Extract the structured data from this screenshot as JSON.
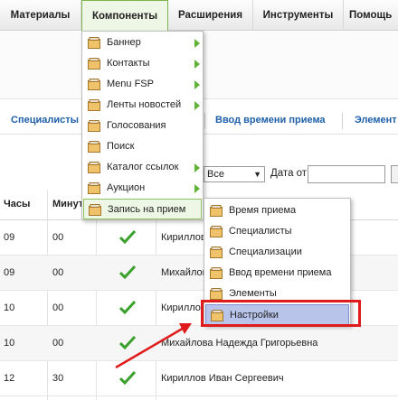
{
  "menubar": {
    "items": [
      {
        "label": "Материалы"
      },
      {
        "label": "Компоненты"
      },
      {
        "label": "Расширения"
      },
      {
        "label": "Инструменты"
      },
      {
        "label": "Помощь"
      }
    ]
  },
  "subbar": {
    "items": [
      {
        "label": "Специалисты"
      },
      {
        "label": "Ввод времени приема"
      },
      {
        "label": "Элемент"
      }
    ]
  },
  "filter": {
    "select_value": "Все",
    "date_from_label": "Дата от"
  },
  "table": {
    "headers": [
      "Часы",
      "Минут"
    ],
    "rows": [
      {
        "hours": "09",
        "minutes": "00",
        "name": "Кириллов"
      },
      {
        "hours": "09",
        "minutes": "00",
        "name": "Михайлов"
      },
      {
        "hours": "10",
        "minutes": "00",
        "name": "Кириллов"
      },
      {
        "hours": "10",
        "minutes": "00",
        "name": "Михайлова Надежда Григорьевна"
      },
      {
        "hours": "12",
        "minutes": "30",
        "name": "Кириллов Иван Сергеевич"
      }
    ]
  },
  "components_menu": {
    "items": [
      {
        "label": "Баннер",
        "submenu": true
      },
      {
        "label": "Контакты",
        "submenu": true
      },
      {
        "label": "Menu FSP",
        "submenu": true
      },
      {
        "label": "Ленты новостей",
        "submenu": true
      },
      {
        "label": "Голосования",
        "submenu": false
      },
      {
        "label": "Поиск",
        "submenu": false
      },
      {
        "label": "Каталог ссылок",
        "submenu": true
      },
      {
        "label": "Аукцион",
        "submenu": true
      },
      {
        "label": "Запись на прием",
        "submenu": false
      }
    ]
  },
  "appointment_menu": {
    "items": [
      {
        "label": "Время приема"
      },
      {
        "label": "Специалисты"
      },
      {
        "label": "Специализации"
      },
      {
        "label": "Ввод времени приема"
      },
      {
        "label": "Элементы"
      },
      {
        "label": "Настройки"
      }
    ]
  },
  "colors": {
    "link": "#1f5fa8",
    "menu_highlight": "#eef6e6",
    "selected_item": "#b9c4ea",
    "annotation_red": "#e01b1b",
    "check_green": "#3aa02c"
  }
}
